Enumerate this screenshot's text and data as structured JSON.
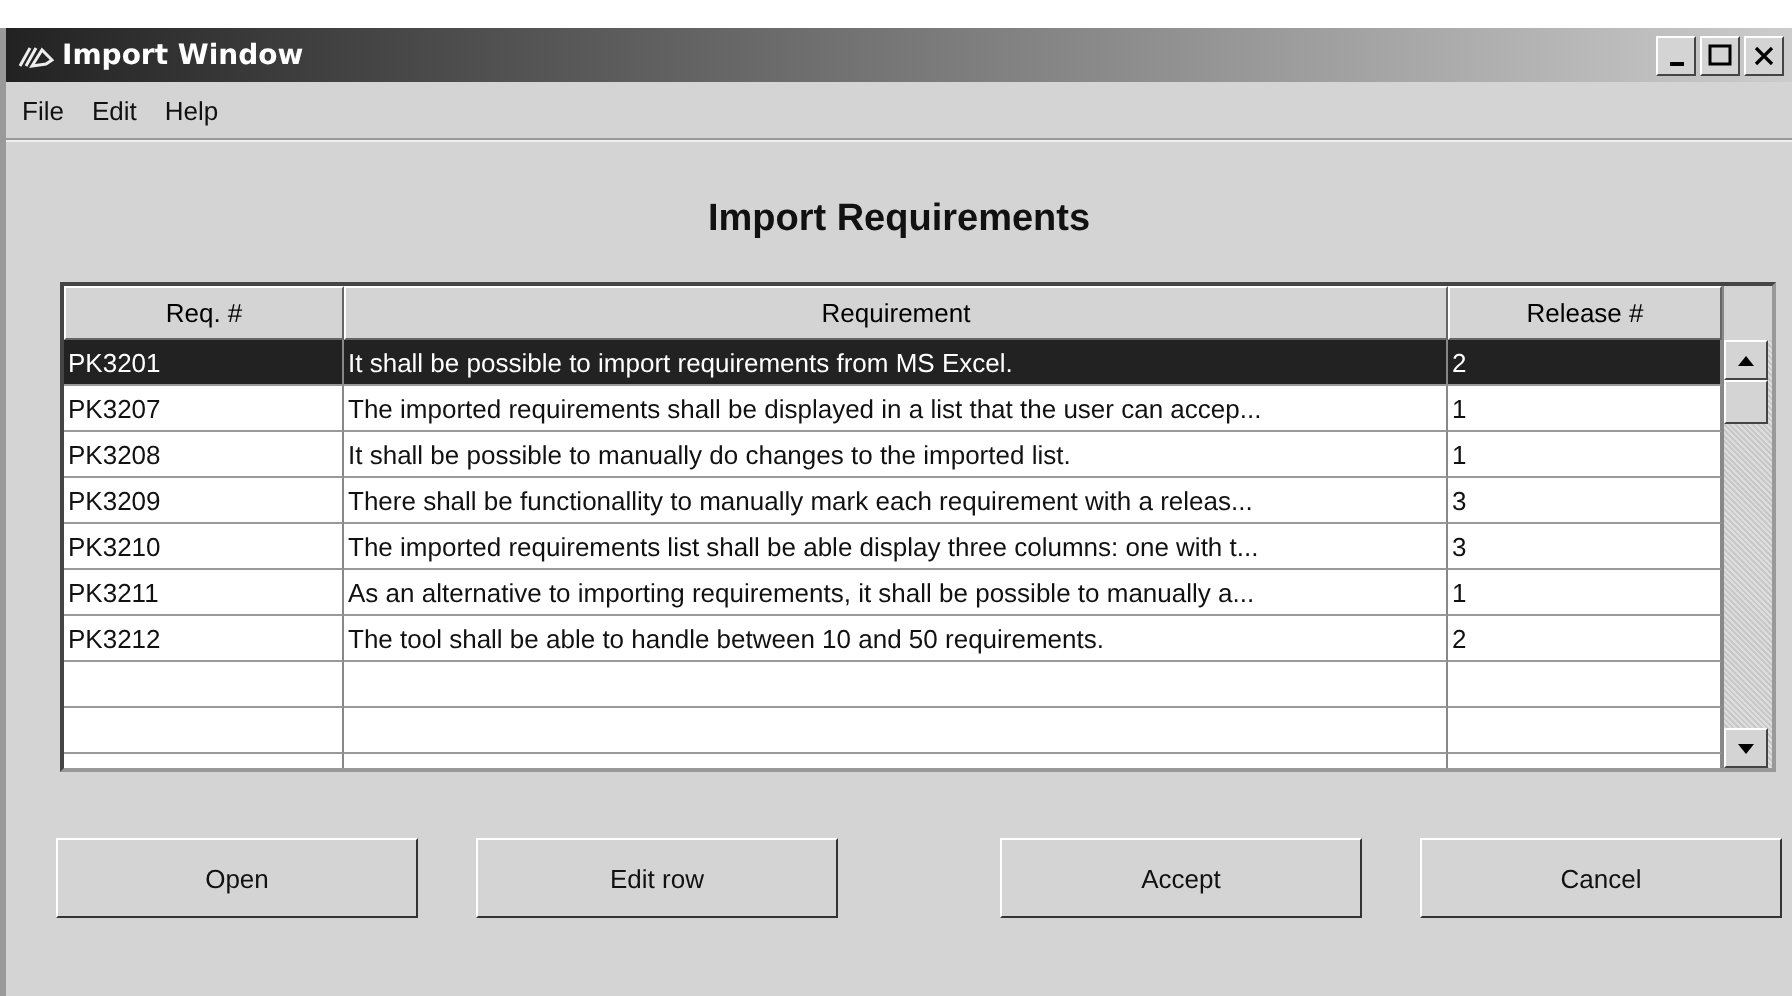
{
  "window": {
    "title": "Import Window"
  },
  "menu": [
    "File",
    "Edit",
    "Help"
  ],
  "heading": "Import Requirements",
  "table": {
    "columns": [
      "Req. #",
      "Requirement",
      "Release #"
    ],
    "rows": [
      {
        "cells": [
          "PK3201",
          "It shall be possible to import requirements from MS Excel.",
          "2"
        ],
        "selected": true
      },
      {
        "cells": [
          "PK3207",
          "The imported requirements shall be displayed in a list that the user can accep...",
          "1"
        ],
        "selected": false
      },
      {
        "cells": [
          "PK3208",
          "It shall be possible to manually do changes to the imported list.",
          "1"
        ],
        "selected": false
      },
      {
        "cells": [
          "PK3209",
          "There shall be functionallity to manually mark each requirement with a releas...",
          "3"
        ],
        "selected": false
      },
      {
        "cells": [
          "PK3210",
          "The imported requirements list shall be able display three columns: one with t...",
          "3"
        ],
        "selected": false
      },
      {
        "cells": [
          "PK3211",
          "As an alternative to importing requirements, it shall be possible to manually a...",
          "1"
        ],
        "selected": false
      },
      {
        "cells": [
          "PK3212",
          "The tool shall be able to handle between 10 and 50 requirements.",
          "2"
        ],
        "selected": false
      }
    ]
  },
  "buttons": [
    "Open",
    "Edit row",
    "Accept",
    "Cancel"
  ]
}
